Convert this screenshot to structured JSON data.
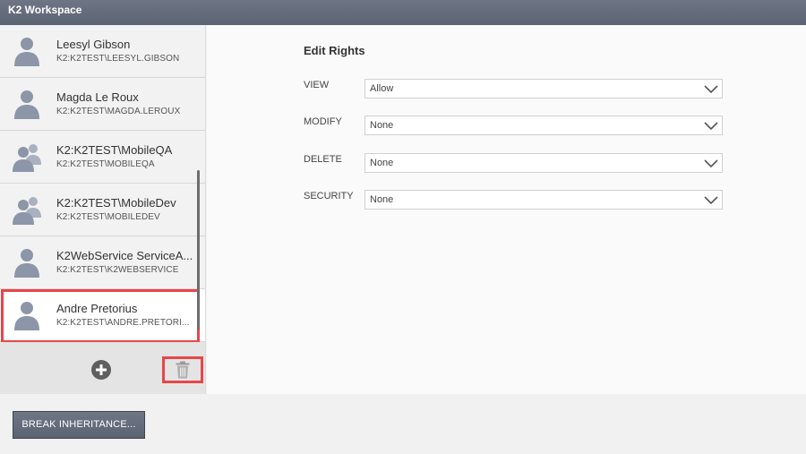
{
  "window": {
    "title": "K2 Workspace"
  },
  "users": [
    {
      "name": "Leesyl Gibson",
      "login": "K2:K2TEST\\LEESYL.GIBSON",
      "icon": "user-icon",
      "selected": false
    },
    {
      "name": "Magda Le Roux",
      "login": "K2:K2TEST\\MAGDA.LEROUX",
      "icon": "user-icon",
      "selected": false
    },
    {
      "name": "K2:K2TEST\\MobileQA",
      "login": "K2:K2TEST\\MOBILEQA",
      "icon": "group-icon",
      "selected": false
    },
    {
      "name": "K2:K2TEST\\MobileDev",
      "login": "K2:K2TEST\\MOBILEDEV",
      "icon": "group-icon",
      "selected": false
    },
    {
      "name": "K2WebService ServiceA...",
      "login": "K2:K2TEST\\K2WEBSERVICE",
      "icon": "user-icon",
      "selected": false
    },
    {
      "name": "Andre Pretorius",
      "login": "K2:K2TEST\\ANDRE.PRETORI...",
      "icon": "user-icon",
      "selected": true
    }
  ],
  "footer": {
    "add_icon": "plus-circle-icon",
    "delete_icon": "trash-icon"
  },
  "edit_rights": {
    "title": "Edit Rights",
    "rows": [
      {
        "label": "VIEW",
        "value": "Allow"
      },
      {
        "label": "MODIFY",
        "value": "None"
      },
      {
        "label": "DELETE",
        "value": "None"
      },
      {
        "label": "SECURITY",
        "value": "None"
      }
    ]
  },
  "actions": {
    "break_inheritance": "BREAK INHERITANCE..."
  },
  "colors": {
    "titlebar": "#5c6373",
    "highlight": "#e8454a",
    "avatar": "#8c96a8"
  }
}
